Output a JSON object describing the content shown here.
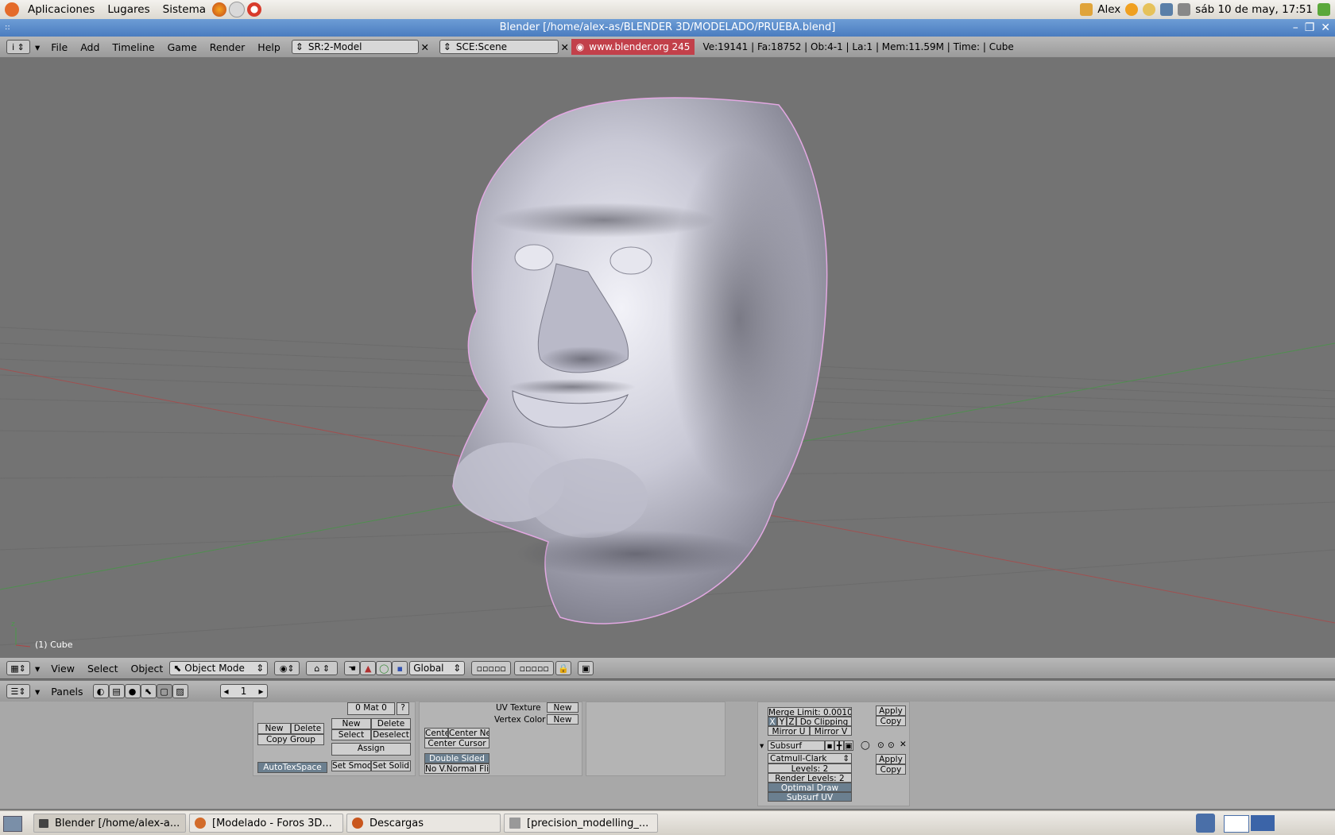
{
  "gnome_panel": {
    "menus": [
      "Aplicaciones",
      "Lugares",
      "Sistema"
    ],
    "user": "Alex",
    "clock": "sáb 10 de may, 17:51"
  },
  "window": {
    "title": "Blender [/home/alex-as/BLENDER 3D/MODELADO/PRUEBA.blend]"
  },
  "main_header": {
    "menus": [
      "File",
      "Add",
      "Timeline",
      "Game",
      "Render",
      "Help"
    ],
    "screen": "SR:2-Model",
    "scene": "SCE:Scene",
    "splash": "www.blender.org 245",
    "stats": "Ve:19141 | Fa:18752 | Ob:4-1 | La:1  | Mem:11.59M  | Time: | Cube"
  },
  "viewport": {
    "object_label": "(1) Cube"
  },
  "view_header": {
    "menus": [
      "View",
      "Select",
      "Object"
    ],
    "mode": "Object Mode",
    "orientation": "Global"
  },
  "buttons_header": {
    "panels_label": "Panels",
    "frame": "1"
  },
  "link_panel": {
    "mat_index": "0 Mat 0",
    "help": "?",
    "new": "New",
    "delete": "Delete",
    "select": "Select",
    "deselect": "Deselect",
    "assign": "Assign",
    "group_new": "New",
    "group_delete": "Delete",
    "copy_group": "Copy Group",
    "autotexspace": "AutoTexSpace",
    "set_smooth": "Set Smoo",
    "set_solid": "Set Solid"
  },
  "mesh_panel": {
    "uv_texture": "UV Texture",
    "vertex_color": "Vertex Color",
    "new1": "New",
    "new2": "New",
    "center": "Cente",
    "center_new": "Center Ne",
    "center_cursor": "Center Cursor",
    "double_sided": "Double Sided",
    "no_vnormal_flip": "No V.Normal Flip"
  },
  "modifiers_panel": {
    "merge_limit": "Merge Limit: 0.0010",
    "x": "X",
    "y": "Y",
    "z": "Z",
    "do_clipping": "Do Clipping",
    "mirror_u": "Mirror U",
    "mirror_v": "Mirror V",
    "apply1": "Apply",
    "copy1": "Copy",
    "subsurf_name": "Subsurf",
    "subsurf_type": "Catmull-Clark",
    "levels": "Levels: 2",
    "render_levels": "Render Levels: 2",
    "optimal_draw": "Optimal Draw",
    "subsurf_uv": "Subsurf UV",
    "apply2": "Apply",
    "copy2": "Copy"
  },
  "taskbar": {
    "tasks": [
      "Blender [/home/alex-a...",
      "[Modelado - Foros 3D...",
      "Descargas",
      "[precision_modelling_..."
    ]
  }
}
